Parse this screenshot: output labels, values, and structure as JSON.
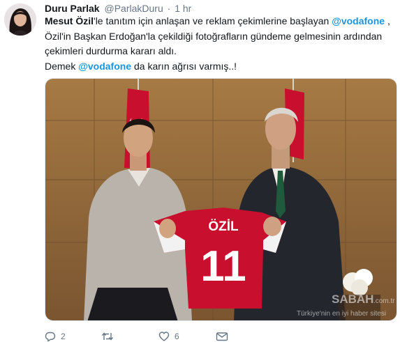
{
  "tweet": {
    "author_name": "Duru Parlak",
    "author_handle": "@ParlakDuru",
    "separator": "·",
    "time": "1 hr",
    "text": {
      "line1_bold": "Mesut Özil",
      "line1_rest": "'le tanıtım için anlaşan ve reklam çekimlerine başlayan ",
      "line1_mention": "@vodafone",
      "line1_end": " ,",
      "line2": "Özil'in Başkan Erdoğan'la çekildiği fotoğrafların gündeme gelmesinin ardından",
      "line3": "çekimleri durdurma kararı aldı.",
      "line4_start": "Demek ",
      "line4_mention": "@vodafone",
      "line4_end": " da karın ağrısı varmış..!"
    }
  },
  "media": {
    "jersey_name": "ÖZİL",
    "jersey_number": "11",
    "watermark_brand": "SABAH",
    "watermark_domain": ".com.tr",
    "watermark_tagline": "Türkiye'nin en iyi haber sitesi"
  },
  "actions": {
    "reply_count": "2",
    "retweet_count": "",
    "like_count": "6"
  },
  "colors": {
    "link": "#1b95e0",
    "muted": "#657786",
    "jersey_red": "#c8102e"
  }
}
